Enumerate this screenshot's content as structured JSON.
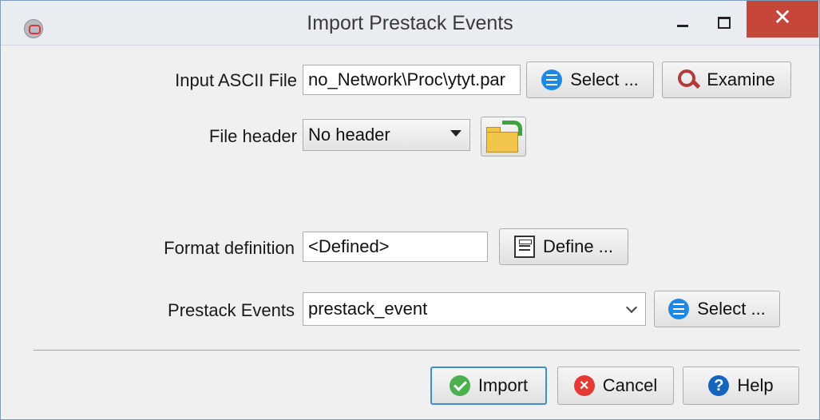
{
  "window": {
    "title": "Import Prestack Events",
    "close_glyph": "✕"
  },
  "input_file": {
    "label": "Input ASCII File",
    "value": "no_Network\\Proc\\ytyt.par",
    "select_label": "Select ...",
    "examine_label": "Examine"
  },
  "file_header": {
    "label": "File header",
    "value": "No header"
  },
  "format": {
    "label": "Format definition",
    "value": "<Defined>",
    "define_label": "Define ..."
  },
  "prestack_events": {
    "label": "Prestack Events",
    "value": "prestack_event",
    "select_label": "Select ..."
  },
  "footer": {
    "import_label": "Import",
    "cancel_label": "Cancel",
    "help_label": "Help"
  },
  "colors": {
    "accent": "#1e88e5",
    "close": "#c7463b",
    "ok": "#4caf50",
    "cancel": "#e53935"
  }
}
